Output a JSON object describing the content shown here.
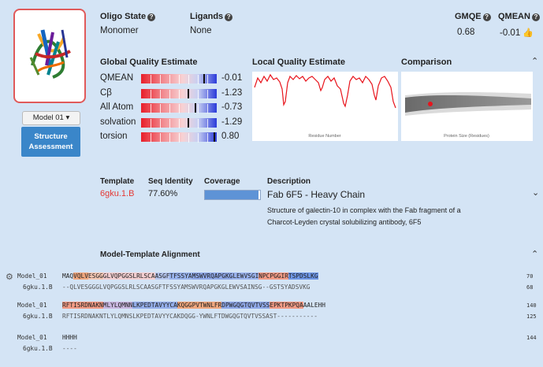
{
  "header": {
    "oligo_label": "Oligo State",
    "oligo_value": "Monomer",
    "ligands_label": "Ligands",
    "ligands_value": "None",
    "gmqe_label": "GMQE",
    "gmqe_value": "0.68",
    "qmean_label": "QMEAN",
    "qmean_value": "-0.01"
  },
  "sidebar": {
    "model_select": "Model 01 ▾",
    "structure_button_line1": "Structure",
    "structure_button_line2": "Assessment"
  },
  "sections": {
    "global": "Global Quality Estimate",
    "local": "Local Quality Estimate",
    "comparison": "Comparison",
    "alignment": "Model-Template Alignment"
  },
  "global_quality": [
    {
      "name": "QMEAN",
      "value": "-0.01",
      "level": 0.83
    },
    {
      "name": "Cβ",
      "value": "-1.23",
      "level": 0.63
    },
    {
      "name": "All Atom",
      "value": "-0.73",
      "level": 0.72
    },
    {
      "name": "solvation",
      "value": "-1.29",
      "level": 0.62
    },
    {
      "name": "torsion",
      "value": "0.80",
      "level": 0.97
    }
  ],
  "local_plot": {
    "xlabel": "Residue Number"
  },
  "comparison_plot": {
    "xlabel": "Protein Size (Residues)"
  },
  "template": {
    "h_template": "Template",
    "h_identity": "Seq Identity",
    "h_coverage": "Coverage",
    "h_description": "Description",
    "id": "6gku.1.B",
    "identity": "77.60%",
    "coverage_fraction": 0.97,
    "title": "Fab 6F5 - Heavy Chain",
    "desc1": "Structure of galectin-10 in complex with the Fab fragment of a",
    "desc2": "Charcot-Leyden crystal solubilizing antibody, 6F5"
  },
  "alignment": {
    "rows": [
      {
        "model_label": "Model_01",
        "model_seq": "MAQVQLVESGGGLVQPGGSLRLSCAASGFTFSSYAMSWVRQAPGKGLEWVSGINPCPGGIRTSPDSLKG",
        "model_num": "70",
        "tmpl_label": "6gku.1.B",
        "tmpl_seq": "--QLVESGGGLVQPGGSLRLSCAASGFTFSSYAMSWVRQAPGKGLEWVSAINSG--GSTSYADSVKG",
        "tmpl_num": "68"
      },
      {
        "model_label": "Model_01",
        "model_seq": "RFTISRDNAKNMLYLQMNNLKPEDTAVYYCAKQGGPVTWNLFRDPWGQGTQVTVSSEPKTPKPQAAALEHH",
        "model_num": "140",
        "tmpl_label": "6gku.1.B",
        "tmpl_seq": "RFTISRDNAKNTLYLQMNSLKPEDTAVYYCAKDQGG-YWNLFTDWGQGTQVTVSSAST-----------",
        "tmpl_num": "125"
      },
      {
        "model_label": "Model_01",
        "model_seq": "HHHH",
        "model_num": "144",
        "tmpl_label": "6gku.1.B",
        "tmpl_seq": "----",
        "tmpl_num": ""
      }
    ]
  },
  "colors": {
    "bg": "#d4e4f5",
    "accent": "#3a86c9",
    "template_id": "#e53935",
    "bar_red": "#e81f2a",
    "bar_blue": "#2b3bd9"
  }
}
